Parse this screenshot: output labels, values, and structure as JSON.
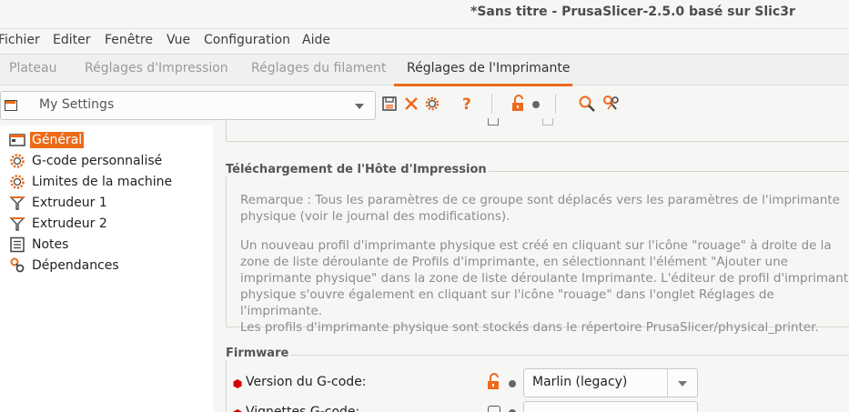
{
  "window": {
    "title": "*Sans titre - PrusaSlicer-2.5.0 basé sur Slic3r"
  },
  "menu": {
    "items": [
      "Fichier",
      "Editer",
      "Fenêtre",
      "Vue",
      "Configuration",
      "Aide"
    ]
  },
  "tabs": {
    "items": [
      "Plateau",
      "Réglages d'Impression",
      "Réglages du filament",
      "Réglages de l'Imprimante"
    ],
    "active": "Réglages de l'Imprimante"
  },
  "toolbar": {
    "preset": "My Settings",
    "icons": [
      "save-icon",
      "delete-icon",
      "gear-icon",
      "question-icon",
      "lock-open-icon",
      "dot-icon",
      "search-icon",
      "compare-icon"
    ]
  },
  "sidebar": {
    "items": [
      {
        "label": "Général",
        "icon": "printer-icon",
        "selected": true
      },
      {
        "label": "G-code personnalisé",
        "icon": "cog-icon"
      },
      {
        "label": "Limites de la machine",
        "icon": "cog-icon"
      },
      {
        "label": "Extrudeur 1",
        "icon": "funnel-icon"
      },
      {
        "label": "Extrudeur 2",
        "icon": "funnel-icon"
      },
      {
        "label": "Notes",
        "icon": "notes-icon"
      },
      {
        "label": "Dépendances",
        "icon": "wrench-icon"
      }
    ]
  },
  "host_upload": {
    "title": "Téléchargement de l'Hôte d'Impression",
    "note1_line1": "Remarque : Tous les paramètres de ce groupe sont déplacés vers les paramètres de l'imprimante",
    "note1_line2": "physique (voir le journal des modifications).",
    "note2_line1": "Un nouveau profil d'imprimante physique est créé en cliquant sur l'icône \"rouage\" à droite de la",
    "note2_line2": "zone de liste déroulante de Profils d'imprimante, en sélectionnant l'élément \"Ajouter une",
    "note2_line3": "imprimante physique\" dans la zone de liste déroulante Imprimante. L'éditeur de profil d'imprimante",
    "note2_line4": "physique s'ouvre également en cliquant sur l'icône \"rouage\" dans l'onglet Réglages de l'imprimante.",
    "note2_line5": "Les profils d'imprimante physique sont stockés dans le répertoire PrusaSlicer/physical_printer."
  },
  "firmware": {
    "title": "Firmware",
    "gcode_flavor_label": "Version du G-code:",
    "gcode_flavor_value": "Marlin (legacy)",
    "thumbnails_label": "Vignettes G-code:"
  },
  "colors": {
    "accent": "#ec6b1a",
    "required": "#d60000"
  }
}
